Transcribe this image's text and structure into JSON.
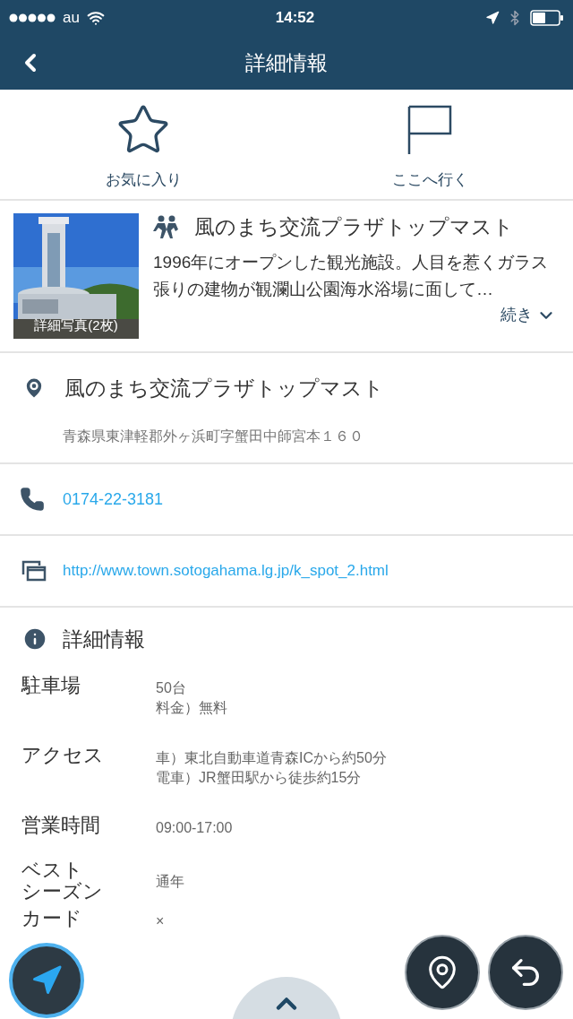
{
  "status_bar": {
    "carrier": "au",
    "time": "14:52"
  },
  "header": {
    "title": "詳細情報"
  },
  "actions": [
    {
      "kind": "star",
      "label": "お気に入り"
    },
    {
      "kind": "flag",
      "label": "ここへ行く"
    }
  ],
  "spot": {
    "photo": {
      "kind": "picture",
      "caption": "詳細写真(2枚)"
    },
    "name": "風のまち交流プラザトップマスト",
    "description": "1996年にオープンした観光施設。人目を惹くガラス張りの建物が観瀾山公園海水浴場に面して…",
    "more": "続き"
  },
  "location": {
    "name": "風のまち交流プラザトップマスト",
    "address": "青森県東津軽郡外ヶ浜町字蟹田中師宮本１６０"
  },
  "phone": "0174-22-3181",
  "url": "http://www.town.sotogahama.lg.jp/k_spot_2.html",
  "details": {
    "title": "詳細情報",
    "rows": [
      {
        "label": "駐車場",
        "lines": [
          "50台",
          "料金）無料"
        ]
      },
      {
        "label": "アクセス",
        "lines": [
          "車）東北自動車道青森ICから約50分",
          "電車）JR蟹田駅から徒歩約15分"
        ]
      },
      {
        "label": "営業時間",
        "lines": [
          "09:00-17:00"
        ]
      },
      {
        "label": [
          "ベスト",
          "シーズン"
        ],
        "lines": [
          "通年"
        ]
      },
      {
        "label": "カード",
        "lines": [
          "×"
        ]
      }
    ]
  }
}
